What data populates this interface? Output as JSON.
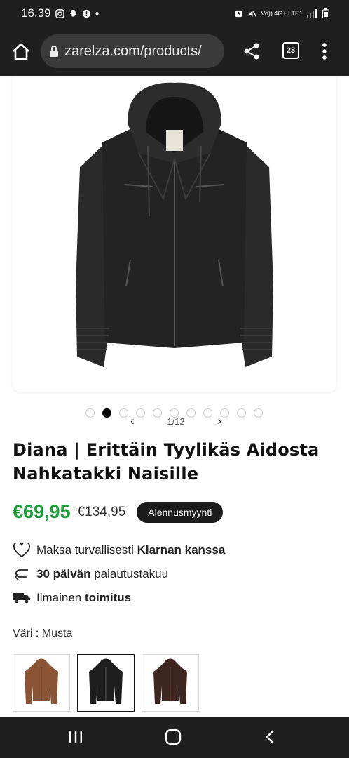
{
  "status": {
    "time": "16.39",
    "network": "Vo)) 4G+ LTE1"
  },
  "browser": {
    "url": "zarelza.com/products/",
    "tab_count": "23"
  },
  "gallery": {
    "current": "1/12",
    "total_dots": 11,
    "active_dot": 1
  },
  "product": {
    "title": "Diana | Erittäin Tyylikäs Aidosta Nahkatakki Naisille",
    "price": "€69,95",
    "old_price": "€134,95",
    "badge": "Alennusmyynti"
  },
  "features": [
    {
      "icon": "heart-icon",
      "prefix": "Maksa turvallisesti ",
      "strong": "Klarnan kanssa",
      "suffix": ""
    },
    {
      "icon": "return-arrow-icon",
      "prefix": "",
      "strong": "30 päivän",
      "suffix": " palautustakuu"
    },
    {
      "icon": "truck-icon",
      "prefix": "Ilmainen ",
      "strong": "toimitus",
      "suffix": ""
    }
  ],
  "color": {
    "label": "Väri : Musta",
    "options": [
      {
        "name": "brown-jacket",
        "color": "#8a5434"
      },
      {
        "name": "black-jacket",
        "color": "#1e1e1e"
      },
      {
        "name": "dark-brown-jacket",
        "color": "#3d2620"
      }
    ],
    "selected_index": 1
  },
  "colors": {
    "chrome": "#1f1f1f",
    "price_green": "#1e9c3a",
    "badge_bg": "#1a1a1a"
  }
}
